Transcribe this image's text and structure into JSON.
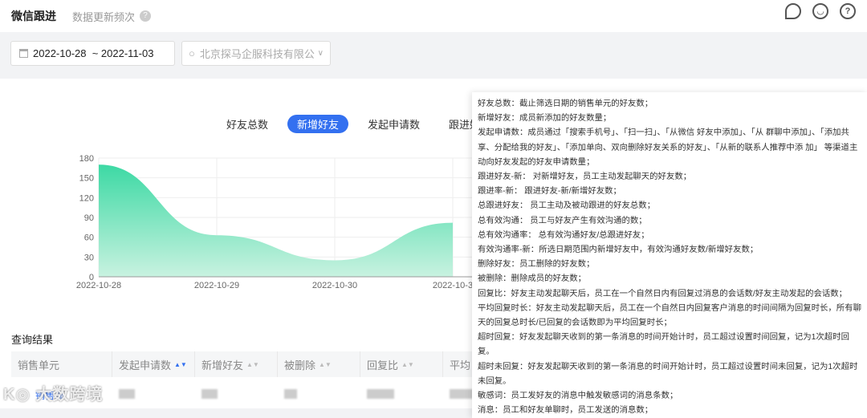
{
  "header": {
    "title": "微信跟进",
    "freq_label": "数据更新频次",
    "icons": [
      "search-icon",
      "chat-icon",
      "help-icon"
    ]
  },
  "filters": {
    "date_range": "2022-10-28  ~ 2022-11-03",
    "company": "北京探马企服科技有限公"
  },
  "tabs": [
    {
      "label": "好友总数"
    },
    {
      "label": "新增好友"
    },
    {
      "label": "发起申请数"
    },
    {
      "label": "跟进好"
    }
  ],
  "chart_data": {
    "type": "area",
    "x": [
      "2022-10-28",
      "2022-10-29",
      "2022-10-30",
      "2022-10-3"
    ],
    "values": [
      170,
      63,
      25,
      82
    ],
    "yticks": [
      0,
      30,
      60,
      90,
      120,
      150,
      180
    ],
    "ylim": [
      0,
      180
    ],
    "grid": true,
    "color": "#3dd9a4",
    "title": "",
    "xlabel": "",
    "ylabel": ""
  },
  "results": {
    "title": "查询结果",
    "columns": [
      "销售单元",
      "发起申请数",
      "新增好友",
      "被删除",
      "回复比",
      "平均"
    ],
    "rows": [
      {
        "unit": "销售部"
      }
    ]
  },
  "logo": "大数跨境",
  "tooltip": [
    "好友总数：截止筛选日期的销售单元的好友数；",
    "新增好友：成员新添加的好友数量；",
    "发起申请数：成员通过「搜索手机号」、「扫一扫」、「从微信 好友中添加」、「从 群聊中添加」、「添加共享、分配给我的好友」、「添加单向、双向删除好友关系的好友」、「从新的联系人推荐中添 加」 等渠道主动向好友发起的好友申请数量；",
    "跟进好友-新： 对新增好友，员工主动发起聊天的好友数；",
    "跟进率-新： 跟进好友-新/新增好友数；",
    "总跟进好友： 员工主动及被动跟进的好友总数；",
    "总有效沟通： 员工与好友产生有效沟通的数；",
    "总有效沟通率： 总有效沟通好友/总跟进好友；",
    "有效沟通率-新：所选日期范围内新增好友中，有效沟通好友数/新增好友数；",
    "删除好友：员工删除的好友数；",
    "被删除：删除成员的好友数；",
    "回复比：好友主动发起聊天后，员工在一个自然日内有回复过消息的会话数/好友主动发起的会话数；",
    "平均回复时长：好友主动发起聊天后，员工在一个自然日内回复客户消息的时间间隔为回复时长，所有聊天的回复总时长/已回复的会话数即为平均回复时长；",
    "超时回复：好友发起聊天收到的第一条消息的时间开始计时，员工超过设置时间回复，记为1次超时回复。",
    "超时未回复：好友发起聊天收到的第一条消息的时间开始计时，员工超过设置时间未回复，记为1次超时未回复。",
    "敏感词：员工发好友的消息中触发敏感词的消息条数；",
    "消息：员工和好友单聊时，员工发送的消息数；"
  ]
}
